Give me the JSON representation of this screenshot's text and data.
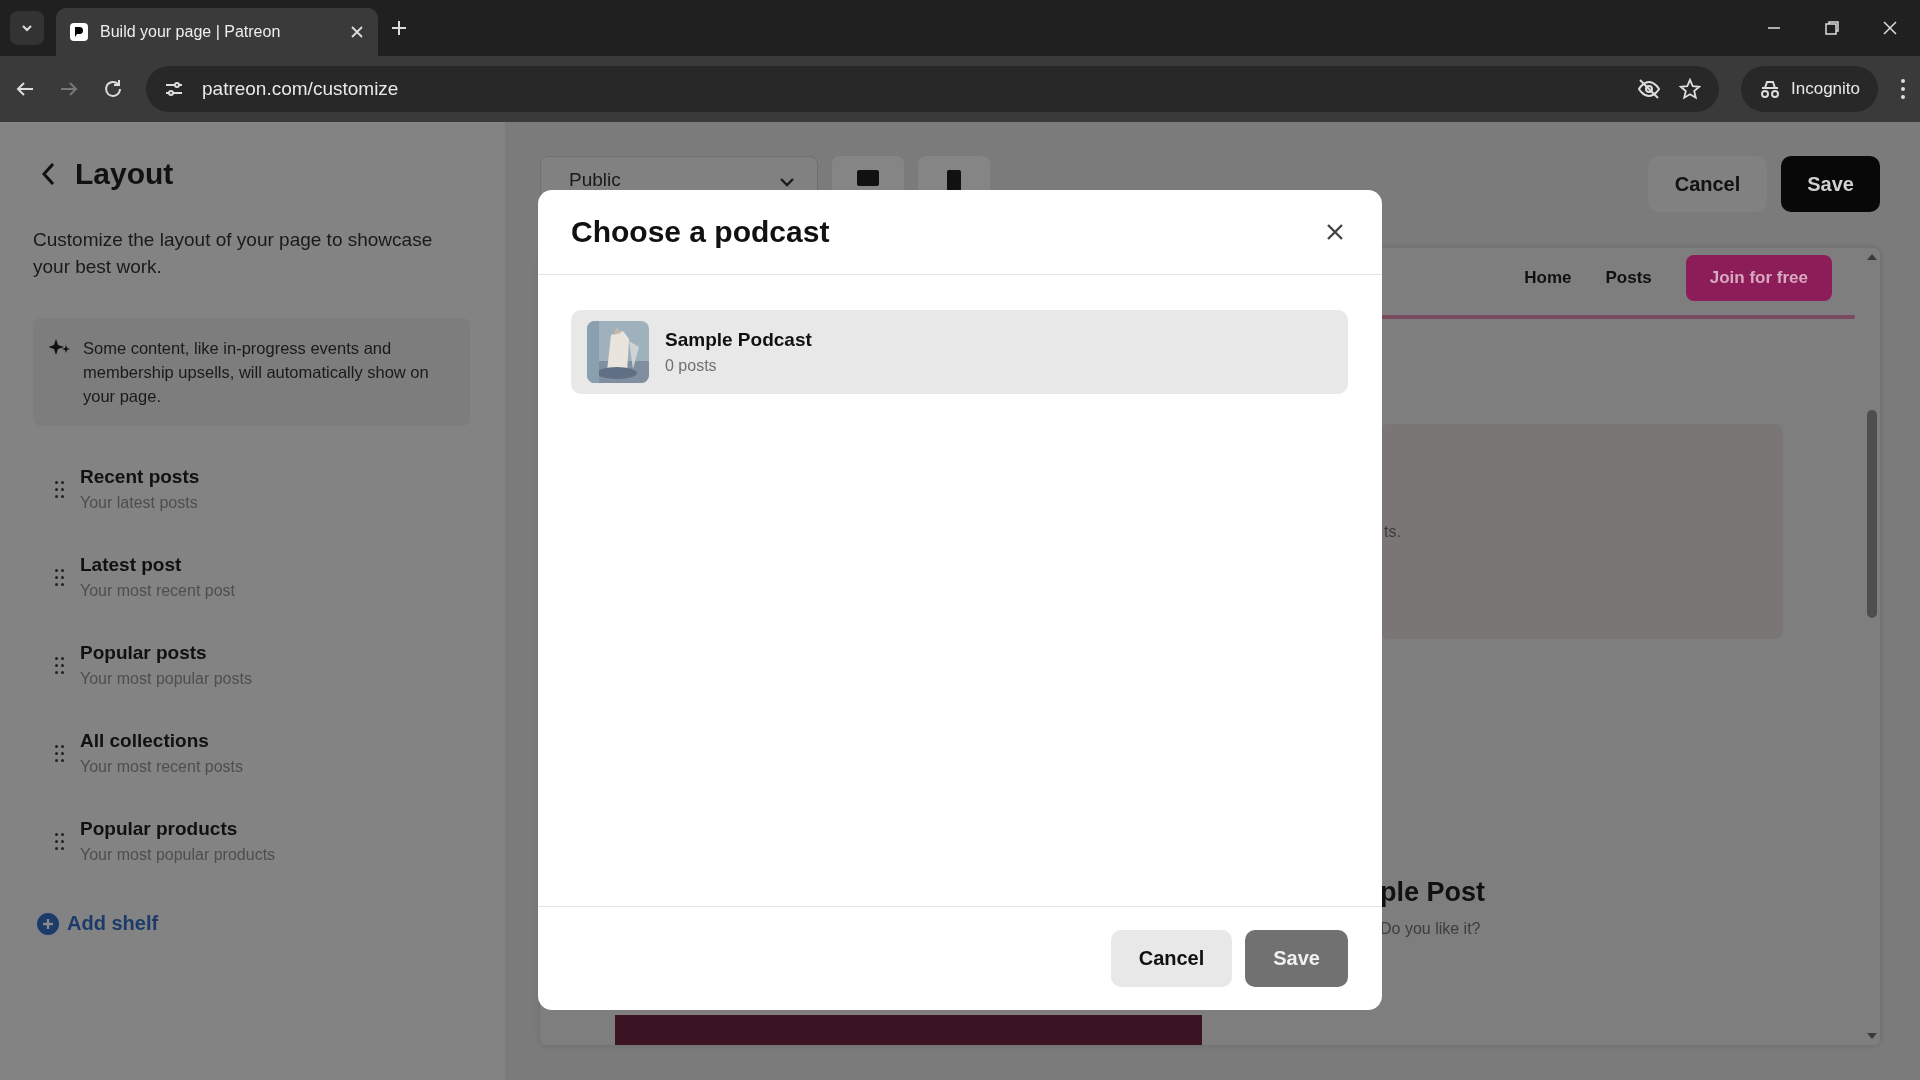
{
  "browser": {
    "tab_title": "Build your page | Patreon",
    "url": "patreon.com/customize",
    "profile": "Incognito"
  },
  "sidebar": {
    "title": "Layout",
    "description": "Customize the layout of your page to showcase your best work.",
    "notice": "Some content, like in-progress events and membership upsells, will automatically show on your page.",
    "shelves": [
      {
        "title": "Recent posts",
        "subtitle": "Your latest posts"
      },
      {
        "title": "Latest post",
        "subtitle": "Your most recent post"
      },
      {
        "title": "Popular posts",
        "subtitle": "Your most popular posts"
      },
      {
        "title": "All collections",
        "subtitle": "Your most recent posts"
      },
      {
        "title": "Popular products",
        "subtitle": "Your most popular products"
      }
    ],
    "add_button": "Add shelf"
  },
  "editor": {
    "visibility": "Public",
    "cancel": "Cancel",
    "save": "Save",
    "preview": {
      "nav": [
        "Home",
        "Posts"
      ],
      "join_button": "Join for free",
      "card_text": "ts.",
      "post_title": "ple Post",
      "post_text": "Do you like it?"
    }
  },
  "modal": {
    "title": "Choose a podcast",
    "podcasts": [
      {
        "name": "Sample Podcast",
        "count": "0 posts",
        "highlighted": true
      }
    ],
    "cancel": "Cancel",
    "save": "Save",
    "save_disabled": true
  }
}
